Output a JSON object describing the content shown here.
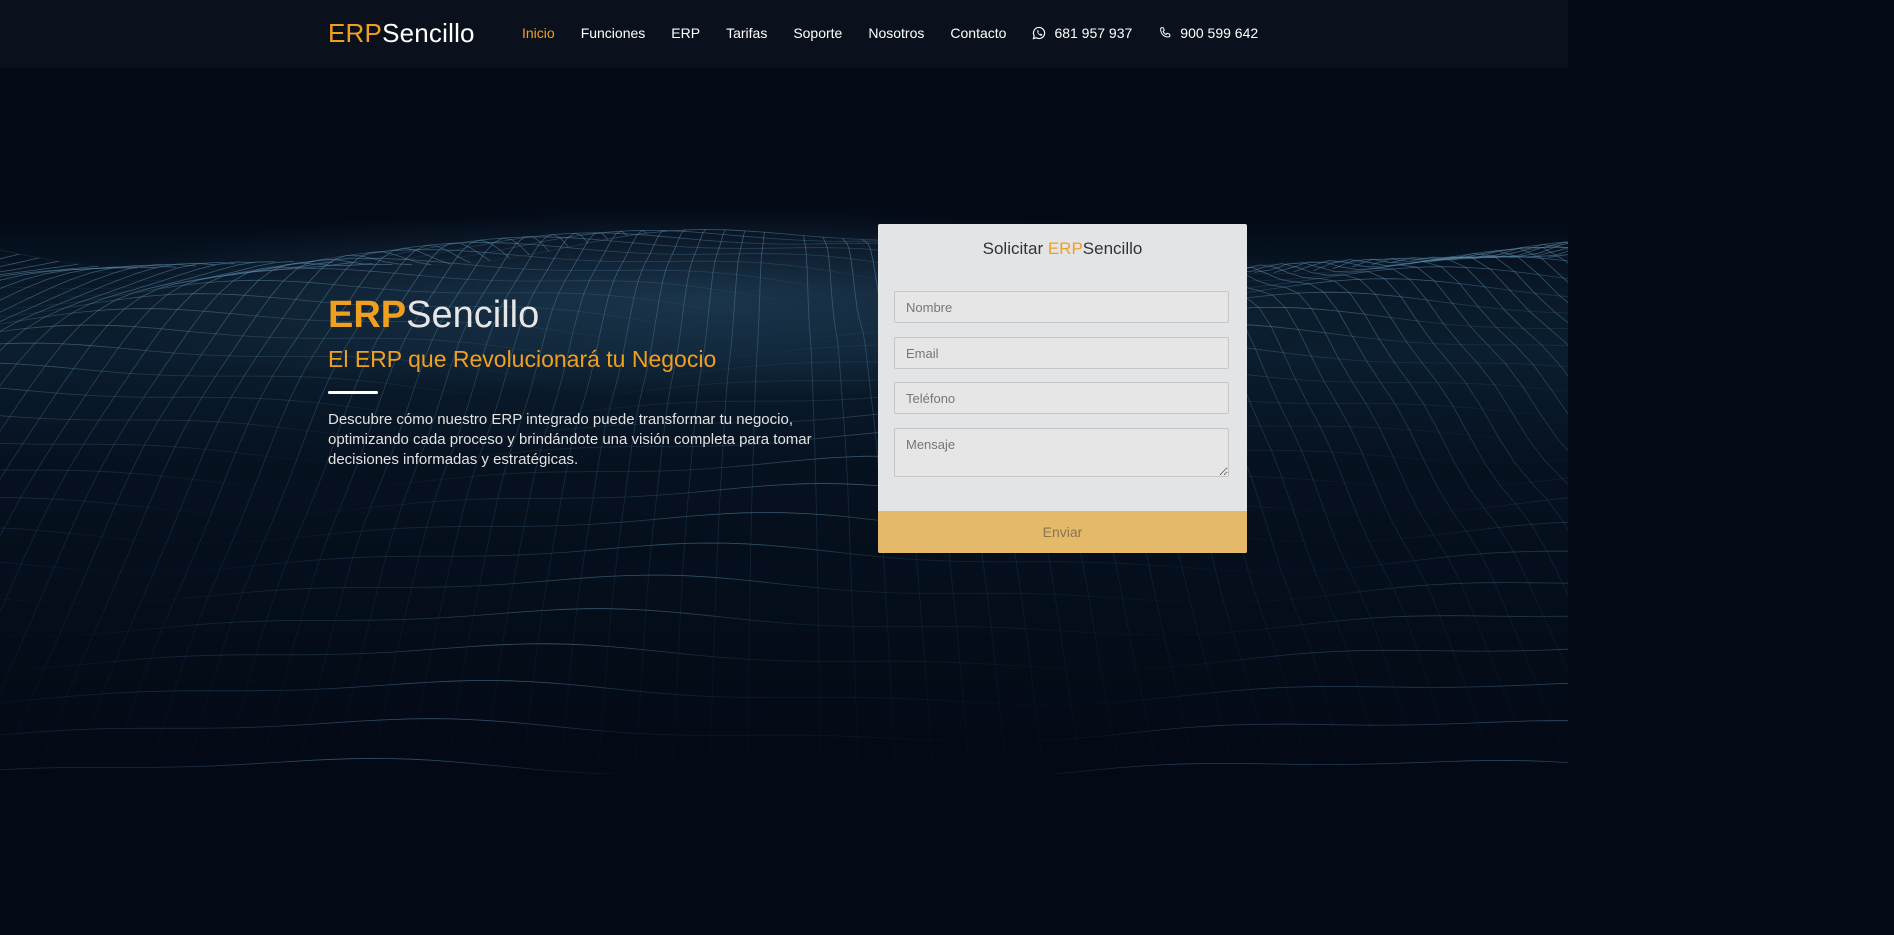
{
  "brand": {
    "part1": "ERP",
    "part2": "Sencillo"
  },
  "colors": {
    "accent": "#f0a01e",
    "navbar_bg": "#0b111c",
    "page_bg": "#030a16",
    "form_bg": "#e3e4e6",
    "button_bg": "#e5b96a"
  },
  "nav": {
    "items": [
      {
        "label": "Inicio",
        "active": true
      },
      {
        "label": "Funciones"
      },
      {
        "label": "ERP"
      },
      {
        "label": "Tarifas"
      },
      {
        "label": "Soporte"
      },
      {
        "label": "Nosotros"
      },
      {
        "label": "Contacto"
      }
    ],
    "whatsapp": {
      "icon": "whatsapp-icon",
      "number": "681 957 937"
    },
    "phone": {
      "icon": "phone-icon",
      "number": "900 599 642"
    }
  },
  "hero": {
    "title_part1": "ERP",
    "title_part2": "Sencillo",
    "subtitle": "El ERP que Revolucionará tu Negocio",
    "description": "Descubre cómo nuestro ERP integrado puede transformar tu negocio, optimizando cada proceso y brindándote una visión completa para tomar decisiones informadas y estratégicas."
  },
  "form": {
    "title_prefix": "Solicitar ",
    "title_part1": "ERP",
    "title_part2": "Sencillo",
    "name_placeholder": "Nombre",
    "email_placeholder": "Email",
    "phone_placeholder": "Teléfono",
    "message_placeholder": "Mensaje",
    "submit_label": "Enviar"
  }
}
